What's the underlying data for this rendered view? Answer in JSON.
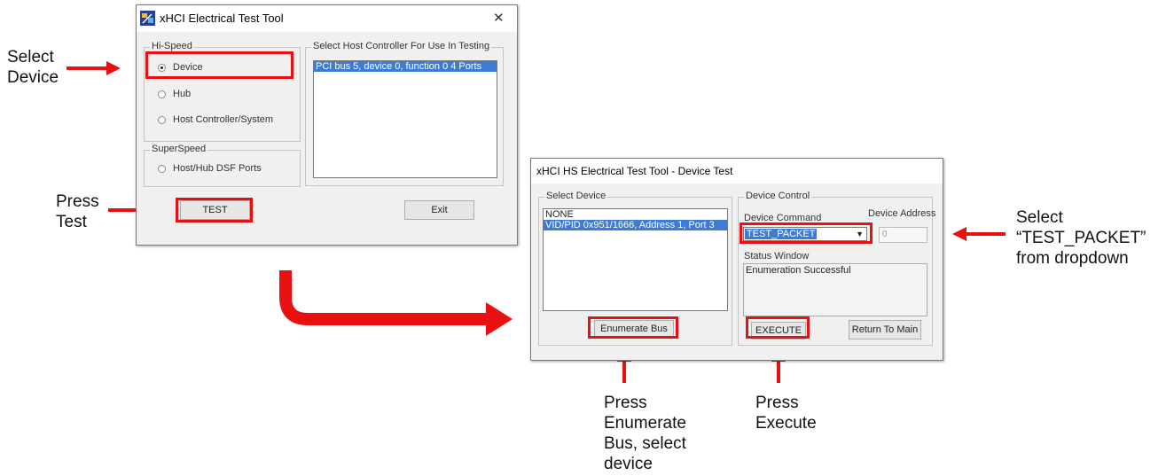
{
  "colors": {
    "annotation_red": "#e81010",
    "selection_blue": "#3d7bd6"
  },
  "main_window": {
    "title": "xHCI Electrical Test Tool",
    "app_icon": "usb-app-icon",
    "close_glyph": "✕",
    "hispeed_group_label": "Hi-Speed",
    "hispeed_options": [
      {
        "label": "Device",
        "checked": true
      },
      {
        "label": "Hub",
        "checked": false
      },
      {
        "label": "Host Controller/System",
        "checked": false
      }
    ],
    "superspeed_group_label": "SuperSpeed",
    "superspeed_options": [
      {
        "label": "Host/Hub DSF Ports",
        "checked": false
      }
    ],
    "controller_group_label": "Select Host Controller For Use In Testing",
    "controller_items": [
      "PCI bus 5, device 0, function 0  4 Ports"
    ],
    "test_label": "TEST",
    "exit_label": "Exit"
  },
  "device_window": {
    "title": "xHCI HS Electrical Test Tool - Device Test",
    "select_device_group_label": "Select Device",
    "device_items": [
      "NONE",
      "VID/PID 0x951/1666, Address 1, Port 3"
    ],
    "enumerate_label": "Enumerate Bus",
    "device_control_group_label": "Device Control",
    "device_command_label": "Device Command",
    "device_command_value": "TEST_PACKET",
    "device_address_label": "Device Address",
    "device_address_value": "0",
    "status_window_label": "Status Window",
    "status_text": "Enumeration Successful",
    "execute_label": "EXECUTE",
    "return_label": "Return To Main"
  },
  "annotations": {
    "select_device": [
      "Select",
      "Device"
    ],
    "press_test": [
      "Press",
      "Test"
    ],
    "select_test_packet": [
      "Select",
      "“TEST_PACKET”",
      "from dropdown"
    ],
    "press_enumerate": [
      "Press",
      "Enumerate",
      "Bus, select",
      "device"
    ],
    "press_execute": [
      "Press",
      "Execute"
    ]
  }
}
